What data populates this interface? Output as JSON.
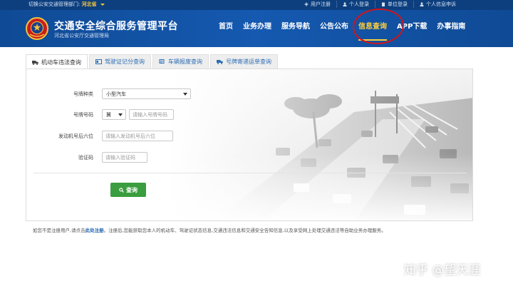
{
  "topbar": {
    "switch_label": "切换公安交通管理部门:",
    "province": "河北省",
    "links": [
      "用户注册",
      "个人登录",
      "单位登录",
      "个人信息申诉"
    ]
  },
  "header": {
    "title": "交通安全综合服务管理平台",
    "subtitle": "河北省公安厅交通管理局",
    "nav": [
      "首页",
      "业务办理",
      "服务导航",
      "公告公布",
      "信息查询",
      "APP下载",
      "办事指南"
    ],
    "active_nav": "信息查询"
  },
  "tabs": [
    {
      "label": "机动车违法查询",
      "icon": "truck-icon"
    },
    {
      "label": "驾驶证记分查询",
      "icon": "card-icon"
    },
    {
      "label": "车辆报废查询",
      "icon": "car-icon"
    },
    {
      "label": "号牌寄递运单查询",
      "icon": "delivery-icon"
    }
  ],
  "form": {
    "plate_type_label": "号牌种类",
    "plate_type_value": "小型汽车",
    "plate_number_label": "号牌号码",
    "plate_prefix_value": "冀",
    "plate_number_placeholder": "请输入号牌号码",
    "engine_label": "发动机号后六位",
    "engine_placeholder": "请输入发动机号后六位",
    "captcha_label": "验证码",
    "captcha_placeholder": "请输入验证码",
    "query_button": "查询"
  },
  "notice": {
    "before": "如您不是注册用户,请点击",
    "link": "此处注册",
    "after": "。注册后,您能获取您本人的机动车、驾驶证状态信息,交通违法信息和交通安全告知信息,以及享受网上处理交通违法等自助业务办理服务。"
  },
  "watermark": "知乎 @望天涯",
  "colors": {
    "topbar": "#0d3f7f",
    "header": "#1559b0",
    "active_nav": "#ffcf3a",
    "button": "#3a9d3f",
    "annotation": "#d0141c"
  }
}
